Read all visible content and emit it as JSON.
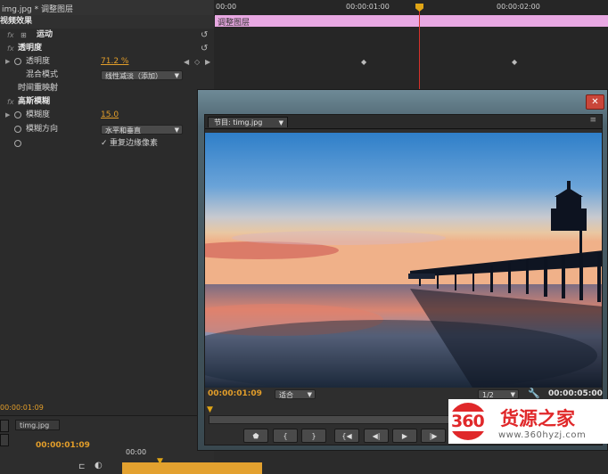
{
  "effect_controls": {
    "clip_path": "img.jpg * 调整图层",
    "section_video_effects": "视频效果",
    "motion": "运动",
    "opacity": "透明度",
    "opacity_param": "透明度",
    "opacity_value": "71.2 %",
    "blend_mode_label": "混合模式",
    "blend_mode_value": "线性减淡（添加）",
    "time_remap": "时间重映射",
    "gaussian_blur": "高斯模糊",
    "blurriness_label": "模糊度",
    "blurriness_value": "15.0",
    "blur_dimension_label": "模糊方向",
    "blur_dimension_value": "水平和垂直",
    "repeat_edge_label": "重复边缘像素",
    "timecode": "00:00:01:09"
  },
  "timeline": {
    "ruler": [
      "00:00",
      "00:00:01:00",
      "00:00:02:00"
    ],
    "clip_name": "调整图层"
  },
  "bottom_panel": {
    "tab": "timg.jpg",
    "timecode": "00:00:01:09",
    "ruler_start": "00:00"
  },
  "program_monitor": {
    "tab_label": "节目: timg.jpg",
    "current_timecode": "00:00:01:09",
    "fit_label": "适合",
    "resolution": "1/2",
    "duration": "00:00:05:00"
  },
  "watermark": {
    "logo_number": "360",
    "logo_text": "货源之家",
    "url": "www.360hyzj.com"
  },
  "colors": {
    "accent_orange": "#e39e2a",
    "clip_pink": "#e8a8e2",
    "playhead_red": "#d7312a"
  }
}
